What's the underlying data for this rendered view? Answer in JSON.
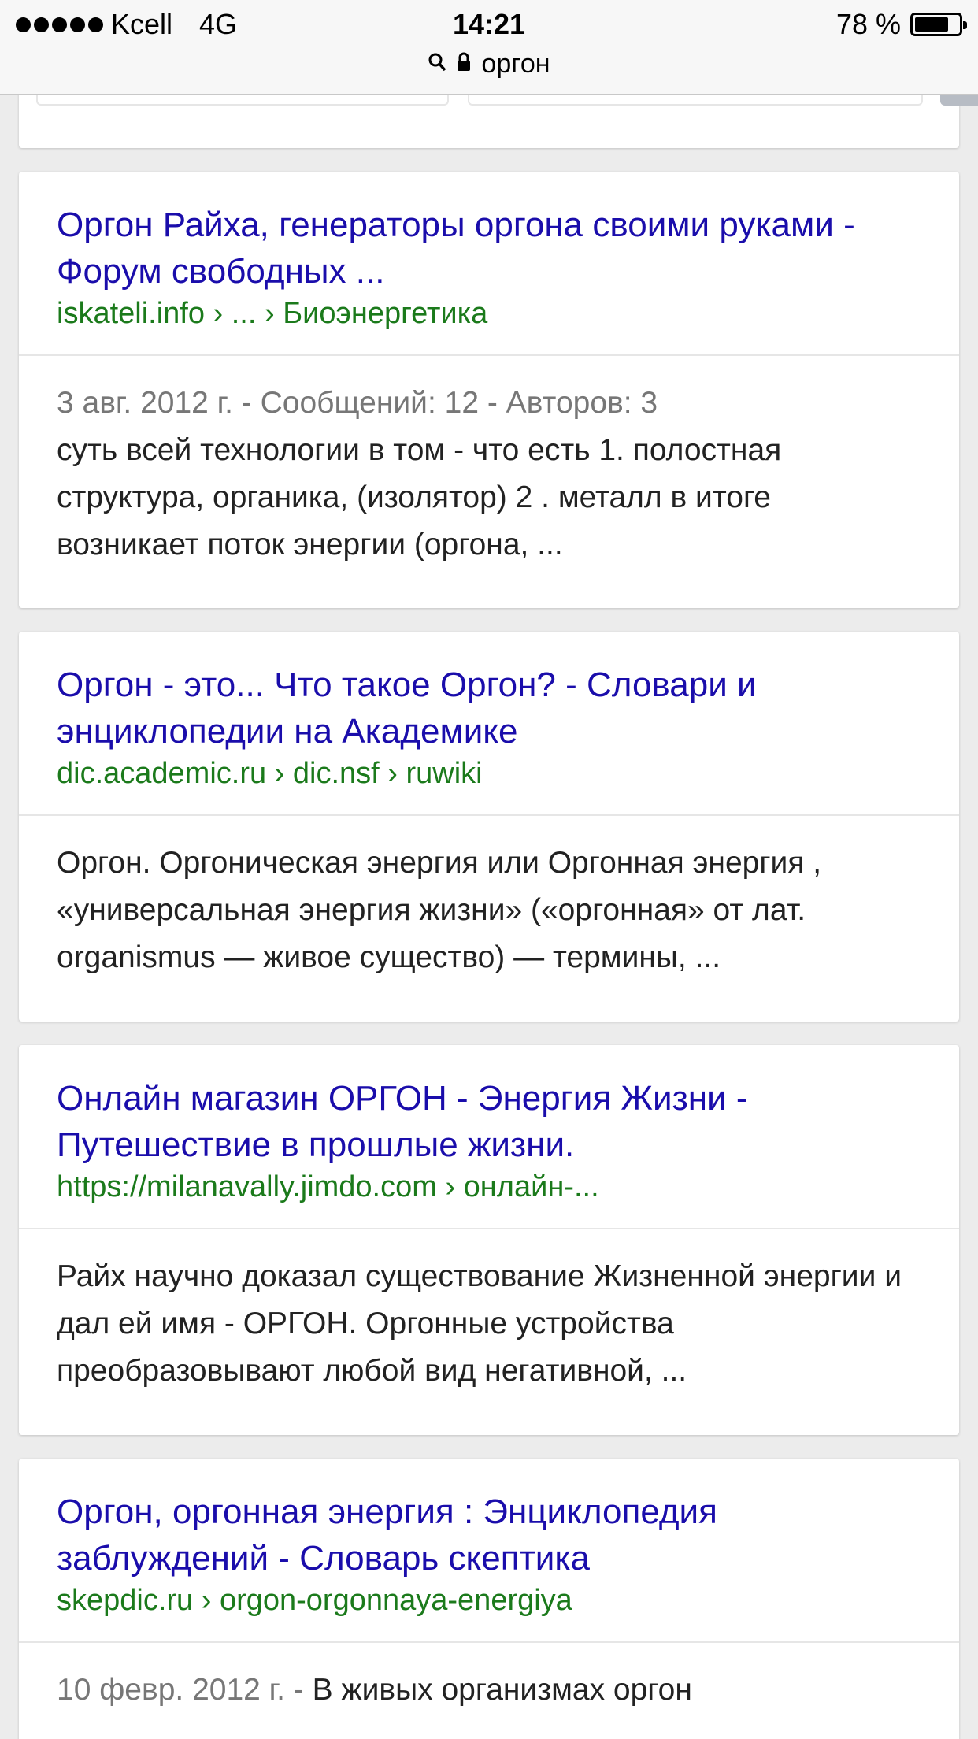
{
  "status_bar": {
    "carrier": "Kcell",
    "network": "4G",
    "time": "14:21",
    "battery": "78 %",
    "battery_level": 0.78
  },
  "url_bar": {
    "search_icon": "search-icon",
    "lock_icon": "lock-icon",
    "text": "оргон"
  },
  "results": [
    {
      "title": "Оргон Райха, генераторы оргона своими руками - Форум свободных ...",
      "cite": "iskateli.info › ... › Биоэнергетика",
      "meta": "3 авг. 2012 г. - Сообщений: 12 - Авторов: 3",
      "snippet": "суть всей технологии в том - что есть 1. полостная структура, органика, (изолятор) 2 . металл в итоге возникает поток энергии (оргона, ..."
    },
    {
      "title": "Оргон - это... Что такое Оргон? - Словари и энциклопедии на Академике",
      "cite": "dic.academic.ru › dic.nsf › ruwiki",
      "meta": "",
      "snippet": "Оргон. Оргоническая энергия или Оргонная энергия , «универсальная энергия жизни» («оргонная» от лат. organismus — живое существо) — термины, ..."
    },
    {
      "title": "Онлайн магазин ОРГОН - Энергия Жизни - Путешествие в прошлые жизни.",
      "cite": "https://milanavally.jimdo.com › онлайн-...",
      "meta": "",
      "snippet": "Райх научно доказал существование Жизненной энергии и дал ей имя - ОРГОН. Оргонные устройства преобразовывают любой вид негативной, ..."
    },
    {
      "title": "Оргон, оргонная энергия : Энциклопедия заблуждений - Словарь скептика",
      "cite": "skepdic.ru › orgon-orgonnaya-energiya",
      "meta": "10 февр. 2012 г. - ",
      "snippet": "В живых организмах оргон"
    }
  ],
  "colors": {
    "link": "#1a0dab",
    "cite": "#1b7a1b",
    "meta": "#777777",
    "background": "#ececec"
  }
}
